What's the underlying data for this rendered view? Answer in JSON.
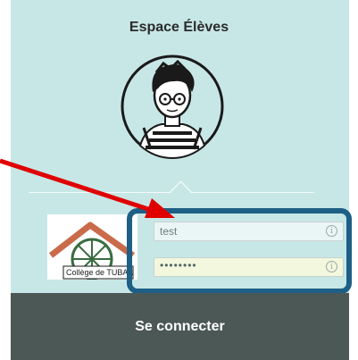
{
  "header": {
    "title": "Espace Élèves"
  },
  "logo": {
    "text": "Collège de TUBAN"
  },
  "form": {
    "username_value": "test",
    "password_value": "••••••••",
    "info_icon": "info-icon"
  },
  "actions": {
    "connect_label": "Se connecter"
  },
  "colors": {
    "panel_bg": "#c7e7e6",
    "button_bg": "#4c5856",
    "highlight_border": "#1e5f86",
    "arrow": "#e00000"
  }
}
